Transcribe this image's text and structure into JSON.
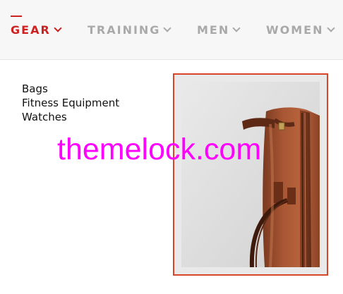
{
  "nav": {
    "items": [
      {
        "label": "GEAR",
        "active": true
      },
      {
        "label": "TRAINING",
        "active": false
      },
      {
        "label": "MEN",
        "active": false
      },
      {
        "label": "WOMEN",
        "active": false
      }
    ],
    "active_color": "#cc2222",
    "inactive_color": "#a9a9a9"
  },
  "dropdown": {
    "links": [
      "Bags",
      "Fitness Equipment",
      "Watches"
    ],
    "promo": {
      "image": "brown-leather-bag",
      "border_color": "#d9452a"
    }
  },
  "watermark": {
    "text": "themelock.com",
    "color": "#ff00ff"
  }
}
